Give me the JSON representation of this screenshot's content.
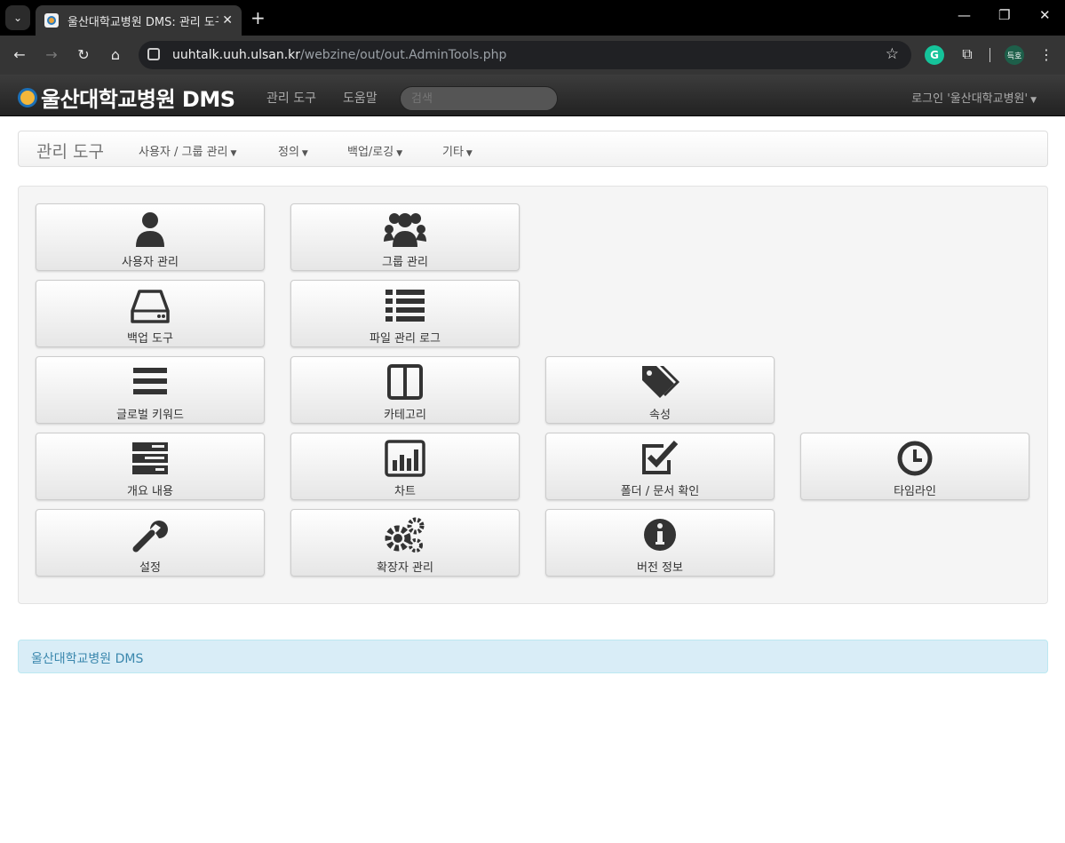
{
  "browser": {
    "tab_title": "울산대학교병원 DMS: 관리 도구",
    "url_host": "uuhtalk.uuh.ulsan.kr",
    "url_path": "/webzine/out/out.AdminTools.php",
    "profile_initials": "득호"
  },
  "navbar": {
    "brand": "울산대학교병원 DMS",
    "links": [
      "관리 도구",
      "도움말"
    ],
    "search_placeholder": "검색",
    "user_menu": "로그인 '울산대학교병원'"
  },
  "subnav": {
    "title": "관리 도구",
    "items": [
      "사용자 / 그룹 관리",
      "정의",
      "백업/로깅",
      "기타"
    ]
  },
  "tiles": [
    {
      "label": "사용자 관리",
      "icon": "user-icon"
    },
    {
      "label": "그룹 관리",
      "icon": "group-icon"
    },
    {
      "label": "백업 도구",
      "icon": "hdd-icon"
    },
    {
      "label": "파일 관리 로그",
      "icon": "list-icon"
    },
    {
      "label": "글로벌 키워드",
      "icon": "reorder-icon"
    },
    {
      "label": "카테고리",
      "icon": "columns-icon"
    },
    {
      "label": "속성",
      "icon": "tags-icon"
    },
    {
      "label": "개요 내용",
      "icon": "tasks-icon"
    },
    {
      "label": "차트",
      "icon": "bar-chart-icon"
    },
    {
      "label": "폴더 / 문서 확인",
      "icon": "check-icon"
    },
    {
      "label": "타임라인",
      "icon": "clock-icon"
    },
    {
      "label": "설정",
      "icon": "wrench-icon"
    },
    {
      "label": "확장자 관리",
      "icon": "cogs-icon"
    },
    {
      "label": "버전 정보",
      "icon": "info-icon"
    }
  ],
  "footer": "울산대학교병원 DMS"
}
